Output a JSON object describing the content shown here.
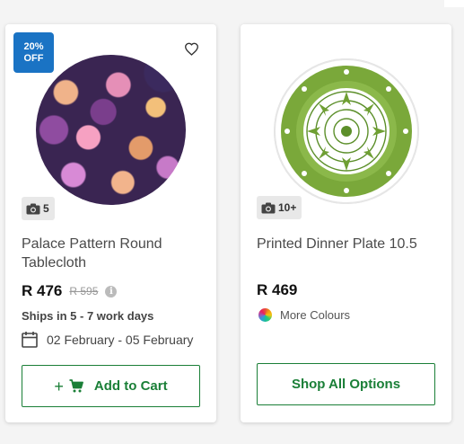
{
  "colors": {
    "accent": "#1a7f37",
    "badge": "#1a73c4",
    "page_bg": "#f4f4f4"
  },
  "products": [
    {
      "badge": "20% OFF",
      "wishlist_icon": "heart-outline-icon",
      "photo_count": "5",
      "title": "Palace Pattern Round Tablecloth",
      "price": "R 476",
      "old_price": "R 595",
      "info_icon": "i",
      "shipping": "Ships in 5 - 7 work days",
      "delivery_dates": "02 February - 05 February",
      "button_label": "Add to Cart",
      "button_prefix": "+"
    },
    {
      "photo_count": "10+",
      "title": "Printed Dinner Plate 10.5",
      "price": "R 469",
      "colours_label": "More Colours",
      "button_label": "Shop All Options"
    }
  ]
}
